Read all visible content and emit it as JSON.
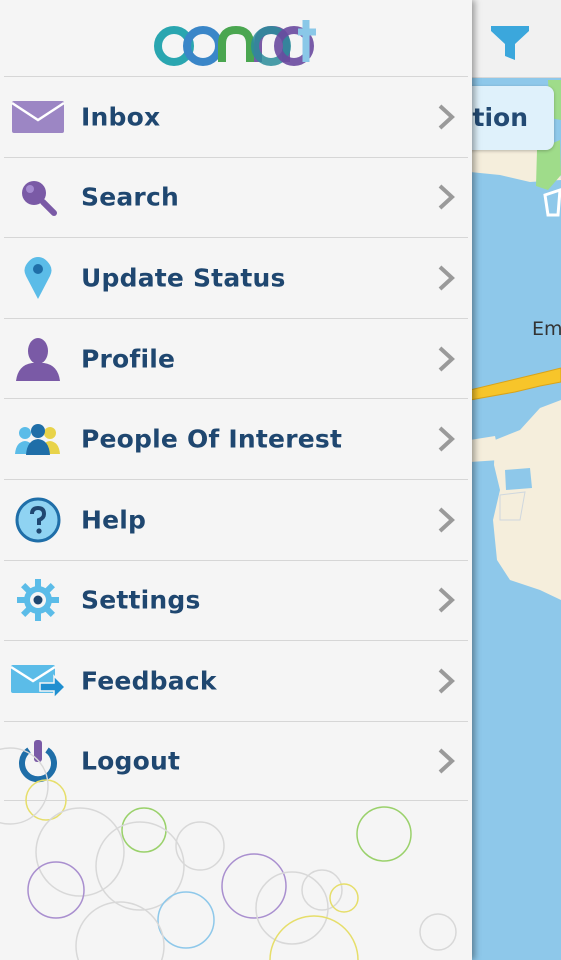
{
  "app": {
    "logo_text": "connect"
  },
  "map": {
    "location_chip_text": "ation",
    "map_label": "Em",
    "filter_icon": "filter-icon"
  },
  "menu": {
    "items": [
      {
        "label": "Inbox",
        "icon": "envelope-icon"
      },
      {
        "label": "Search",
        "icon": "magnifier-icon"
      },
      {
        "label": "Update Status",
        "icon": "location-pin-icon"
      },
      {
        "label": "Profile",
        "icon": "person-icon"
      },
      {
        "label": "People Of Interest",
        "icon": "people-group-icon"
      },
      {
        "label": "Help",
        "icon": "question-mark-icon"
      },
      {
        "label": "Settings",
        "icon": "gear-icon"
      },
      {
        "label": "Feedback",
        "icon": "send-mail-icon"
      },
      {
        "label": "Logout",
        "icon": "power-icon"
      }
    ]
  },
  "colors": {
    "label_text": "#1f4770",
    "drawer_bg": "#f5f5f5",
    "map_water": "#8ec8ea",
    "map_land": "#f5eedc",
    "road": "#f7c52a",
    "accent_blue": "#3ba7dc",
    "accent_purple": "#7a5aa6"
  }
}
